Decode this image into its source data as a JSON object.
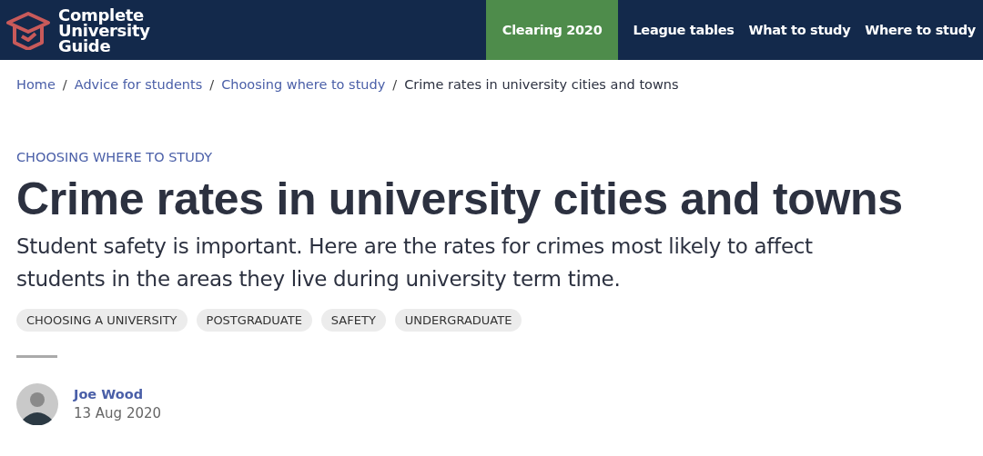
{
  "header": {
    "logo_lines": [
      "Complete",
      "University",
      "Guide"
    ],
    "nav": [
      {
        "label": "Clearing 2020",
        "selected": true
      },
      {
        "label": "League tables",
        "selected": false
      },
      {
        "label": "What to study",
        "selected": false
      },
      {
        "label": "Where to study",
        "selected": false
      }
    ]
  },
  "breadcrumb": [
    {
      "label": "Home",
      "current": false
    },
    {
      "label": "Advice for students",
      "current": false
    },
    {
      "label": "Choosing where to study",
      "current": false
    },
    {
      "label": "Crime rates in university cities and towns",
      "current": true
    }
  ],
  "breadcrumb_separator": "/",
  "article": {
    "category": "CHOOSING WHERE TO STUDY",
    "title": "Crime rates in university cities and towns",
    "subtitle": "Student safety is important. Here are the rates for crimes most likely to affect students in the areas they live during university term time.",
    "tags": [
      "CHOOSING A UNIVERSITY",
      "POSTGRADUATE",
      "SAFETY",
      "UNDERGRADUATE"
    ],
    "author": {
      "name": "Joe Wood",
      "date": "13 Aug 2020"
    }
  }
}
